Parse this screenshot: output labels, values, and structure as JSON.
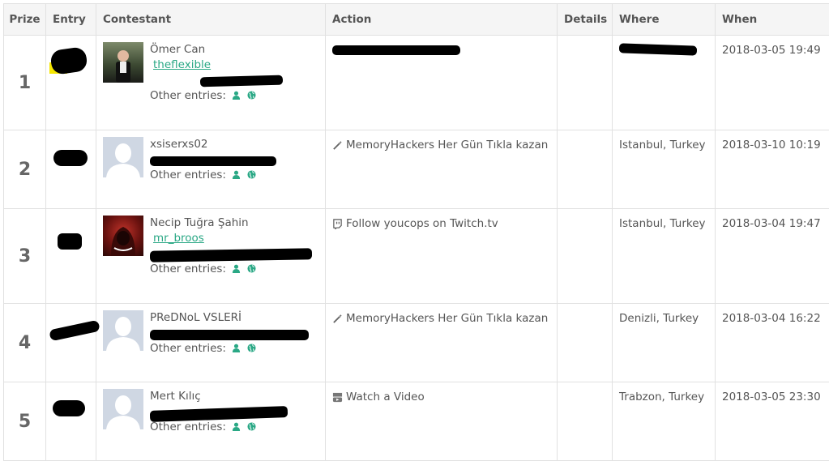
{
  "headers": {
    "prize": "Prize",
    "entry": "Entry",
    "contestant": "Contestant",
    "action": "Action",
    "details": "Details",
    "where": "Where",
    "when": "When"
  },
  "rows": [
    {
      "prize": "1",
      "name": "Ömer Can",
      "handle": "theflexible",
      "other_entries": "Other entries:",
      "action": "",
      "action_icon": "checkbox-icon",
      "where": "",
      "when": "2018-03-05 19:49"
    },
    {
      "prize": "2",
      "name": "xsiserxs02",
      "handle": "",
      "other_entries": "Other entries:",
      "action": "MemoryHackers Her Gün Tıkla kazan",
      "action_icon": "magic-wand-icon",
      "where": "Istanbul, Turkey",
      "when": "2018-03-10 10:19"
    },
    {
      "prize": "3",
      "name": "Necip Tuğra Şahin",
      "handle": "mr_broos",
      "other_entries": "Other entries:",
      "action": "Follow youcops on Twitch.tv",
      "action_icon": "twitch-icon",
      "where": "Istanbul, Turkey",
      "when": "2018-03-04 19:47"
    },
    {
      "prize": "4",
      "name": "PReDNoL VSLERİ",
      "handle": "",
      "other_entries": "Other entries:",
      "action": "MemoryHackers Her Gün Tıkla kazan",
      "action_icon": "magic-wand-icon",
      "where": "Denizli, Turkey",
      "when": "2018-03-04 16:22"
    },
    {
      "prize": "5",
      "name": "Mert Kılıç",
      "handle": "",
      "other_entries": "Other entries:",
      "action": "Watch a Video",
      "action_icon": "youtube-icon",
      "where": "Trabzon, Turkey",
      "when": "2018-03-05 23:30"
    }
  ],
  "colors": {
    "accent": "#2aa885",
    "header_bg": "#f5f5f5",
    "border": "#e1e1e1",
    "redaction": "#000000"
  }
}
